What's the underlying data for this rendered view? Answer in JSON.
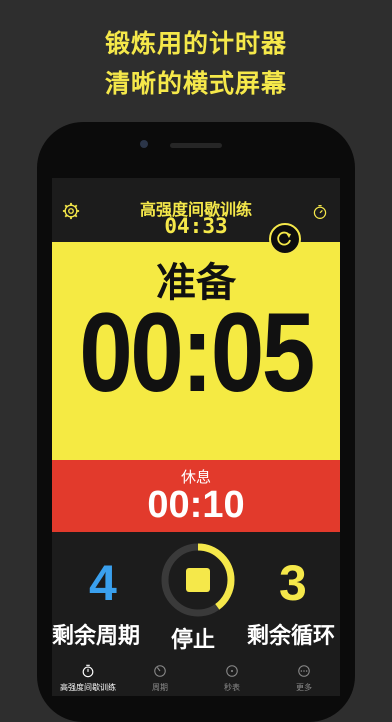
{
  "promo": {
    "line1": "锻炼用的计时器",
    "line2": "清晰的横式屏幕"
  },
  "header": {
    "title": "高强度间歇训练",
    "elapsed": "04:33"
  },
  "phase": {
    "label": "准备",
    "time": "00:05"
  },
  "next": {
    "label": "休息",
    "time": "00:10"
  },
  "stats": {
    "periods_value": "4",
    "periods_label": "剩余周期",
    "cycles_value": "3",
    "cycles_label": "剩余循环",
    "stop_label": "停止",
    "stop_progress": 0.4
  },
  "tabs": [
    {
      "label": "高强度间歇训练",
      "icon": "stopwatch-icon",
      "active": true
    },
    {
      "label": "周期",
      "icon": "timer-icon",
      "active": false
    },
    {
      "label": "秒表",
      "icon": "stopwatch-icon",
      "active": false
    },
    {
      "label": "更多",
      "icon": "more-icon",
      "active": false
    }
  ],
  "colors": {
    "accent": "#f5e84a",
    "phase_bg": "#f5ea43",
    "next_bg": "#e23a2c",
    "periods": "#3aa0ee"
  }
}
